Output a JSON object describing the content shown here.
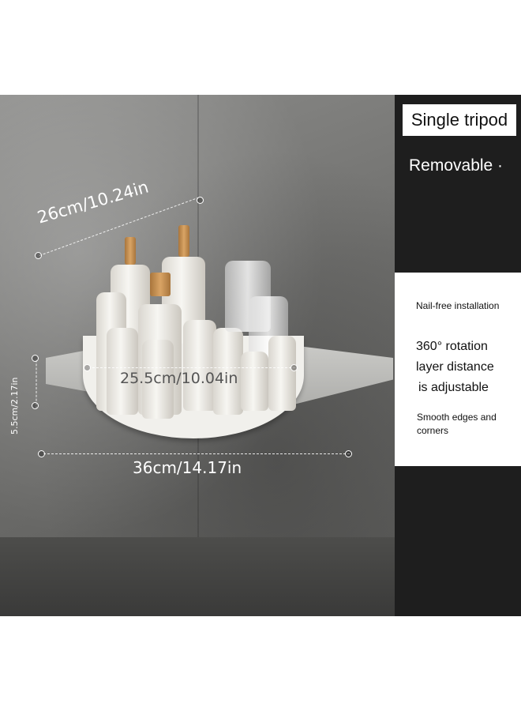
{
  "labels": {
    "single_tripod": "Single tripod",
    "removable": "Removable ·",
    "nail_free": "Nail-free installation",
    "rotation_line1": "360° rotation",
    "rotation_line2": "layer distance",
    "rotation_line3": "is adjustable",
    "smooth_line1": "Smooth edges and",
    "smooth_line2": "corners"
  },
  "dimensions": {
    "depth": "26cm/10.24in",
    "tray_width": "25.5cm/10.04in",
    "height": "5.5cm/2.17in",
    "total_width": "36cm/14.17in"
  }
}
